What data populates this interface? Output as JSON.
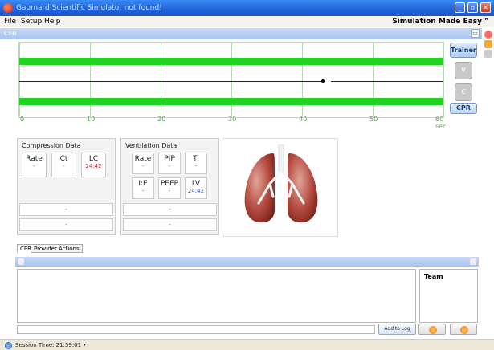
{
  "window": {
    "title": "Gaumard Scientific Simulator not found!"
  },
  "menu": {
    "items": [
      "File",
      "Setup",
      "Help"
    ],
    "tagline": "Simulation Made Easy™"
  },
  "cpr_panel": {
    "label": "CPR",
    "restore_icon": "restore-icon"
  },
  "waveform": {
    "x_ticks": [
      "0",
      "10",
      "20",
      "30",
      "40",
      "50",
      "60 sec"
    ],
    "marker_seconds": 43
  },
  "side_buttons": {
    "trainer": "Trainer",
    "v": "V",
    "c": "C",
    "cpr": "CPR"
  },
  "compression": {
    "title": "Compression Data",
    "fields": [
      {
        "label": "Rate",
        "value": "-"
      },
      {
        "label": "Ct",
        "value": "-"
      },
      {
        "label": "LC",
        "value": "24:42"
      }
    ],
    "rows": [
      "-",
      "-"
    ]
  },
  "ventilation": {
    "title": "Ventilation Data",
    "fields": [
      {
        "label": "Rate",
        "value": "-"
      },
      {
        "label": "PIP",
        "value": "-"
      },
      {
        "label": "Ti",
        "value": "-"
      },
      {
        "label": "I:E",
        "value": "-"
      },
      {
        "label": "PEEP",
        "value": "-"
      },
      {
        "label": "LV",
        "value": "24:42"
      }
    ],
    "rows": [
      "-",
      "-"
    ]
  },
  "tabs": [
    "CPR",
    "Provider Actions"
  ],
  "team": {
    "title": "Team"
  },
  "log": {
    "add_button": "Add to Log"
  },
  "status": {
    "session": "Session Time: 21:59:01 •"
  },
  "colors": {
    "band": "#21d321",
    "title_bar": "#1f62d8",
    "red_value": "#d02020",
    "blue_value": "#2f4fcf"
  }
}
